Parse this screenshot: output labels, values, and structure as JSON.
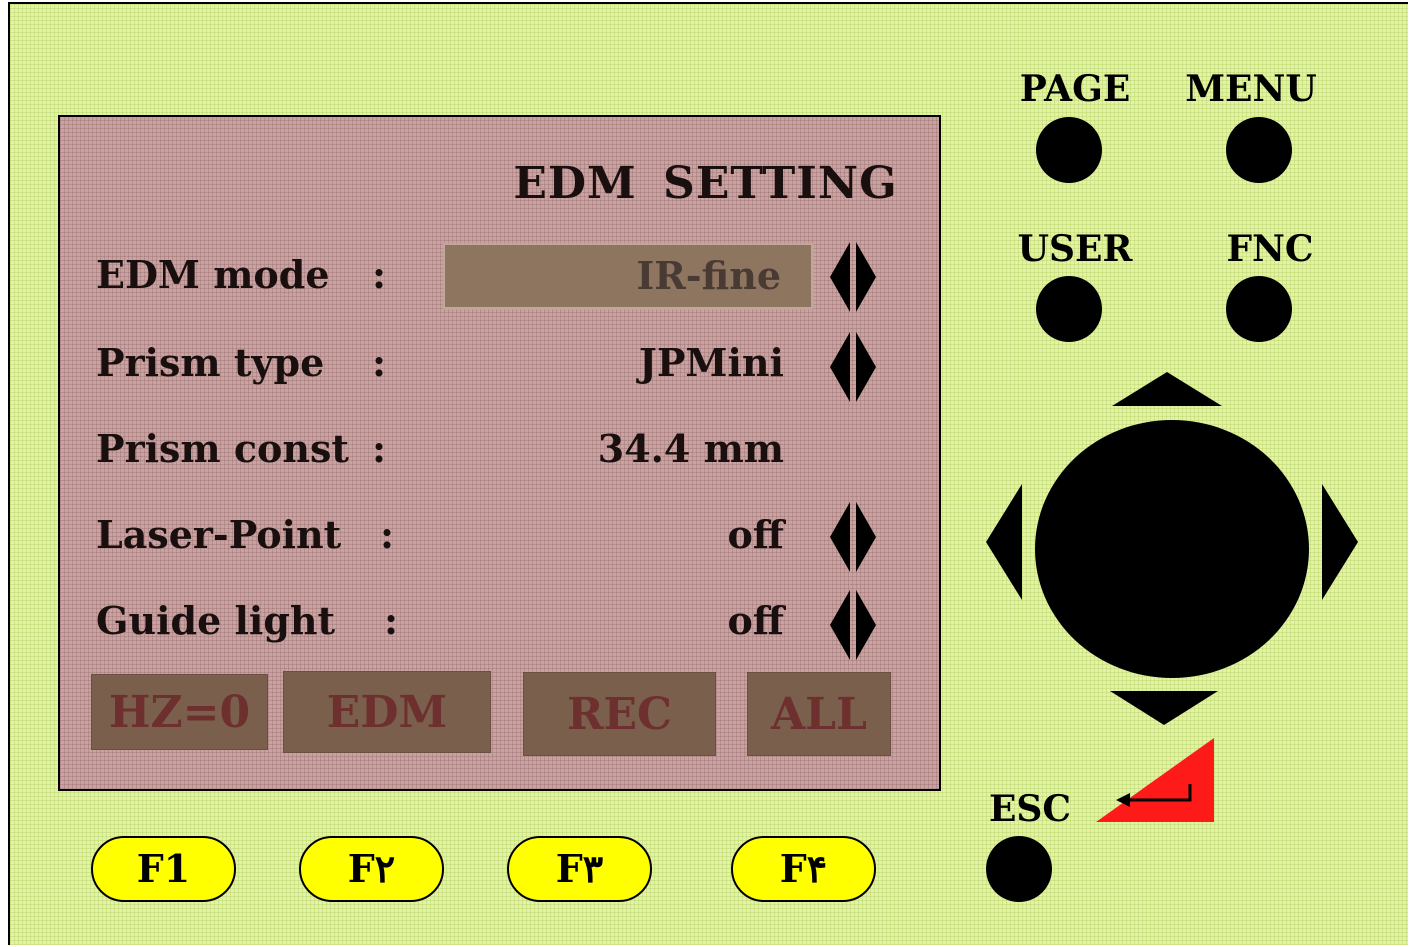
{
  "screen": {
    "title": "EDM  SETTING",
    "rows": [
      {
        "label": "EDM mode",
        "colon": ":",
        "value": "IR-fine",
        "selected": true,
        "has_arrows": true
      },
      {
        "label": "Prism type",
        "colon": ":",
        "value": "JPMini",
        "selected": false,
        "has_arrows": true
      },
      {
        "label": "Prism const",
        "colon": ":",
        "value": "34.4 mm",
        "selected": false,
        "has_arrows": false
      },
      {
        "label": "Laser-Point",
        "colon": ":",
        "value": "off",
        "selected": false,
        "has_arrows": true
      },
      {
        "label": "Guide light",
        "colon": ":",
        "value": "off",
        "selected": false,
        "has_arrows": true
      }
    ],
    "softkeys": [
      "HZ=0",
      "EDM",
      "REC",
      "ALL"
    ]
  },
  "function_keys": [
    "F1",
    "F۲",
    "F۳",
    "F۴"
  ],
  "buttons": {
    "page": "PAGE",
    "menu": "MENU",
    "user": "USER",
    "fnc": "FNC",
    "esc": "ESC"
  },
  "icons": {
    "dpad_up": "triangle-up-icon",
    "dpad_down": "triangle-down-icon",
    "dpad_left": "triangle-left-icon",
    "dpad_right": "triangle-right-icon",
    "enter": "enter-return-icon",
    "row_arrows": "left-right-arrows-icon"
  },
  "colors": {
    "device_bg": "#e4f2a6",
    "screen_bg": "#c9a2a2",
    "fkey_bg": "#ffff00",
    "enter_key": "#ff1a1a",
    "softkey_bg": "#7a5f4c"
  }
}
